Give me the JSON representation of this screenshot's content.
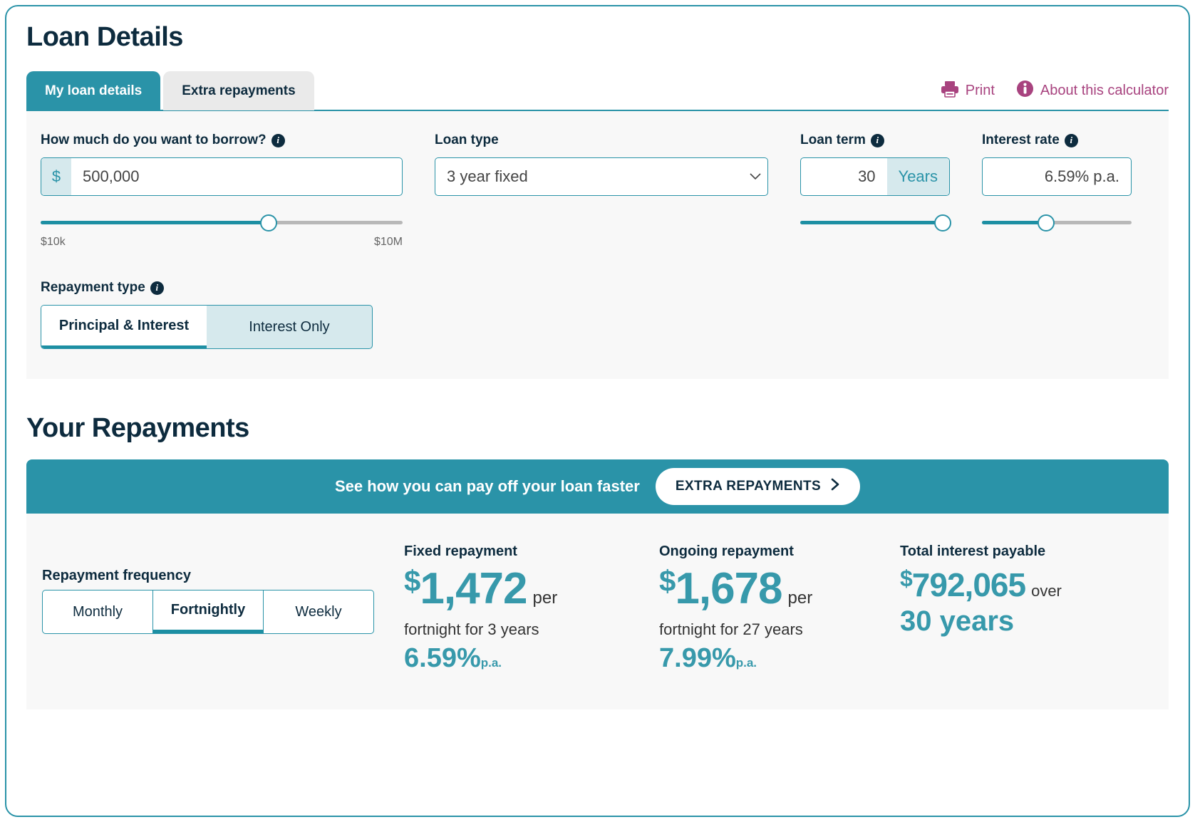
{
  "header": {
    "title": "Loan Details"
  },
  "tabs": [
    {
      "label": "My loan details",
      "active": true
    },
    {
      "label": "Extra repayments",
      "active": false
    }
  ],
  "actions": {
    "print_label": "Print",
    "print_icon": "printer-icon",
    "about_label": "About this calculator",
    "about_icon": "info-circle-icon",
    "link_color": "#a8437f"
  },
  "form": {
    "borrow": {
      "label": "How much do you want to borrow?",
      "info_icon": "info-icon",
      "prefix": "$",
      "value": "500,000",
      "slider": {
        "min_label": "$10k",
        "max_label": "$10M",
        "percent": 63
      }
    },
    "loan_type": {
      "label": "Loan type",
      "value": "3 year fixed",
      "chevron_icon": "chevron-down-icon"
    },
    "loan_term": {
      "label": "Loan term",
      "info_icon": "info-icon",
      "value": "30",
      "suffix": "Years",
      "slider": {
        "percent": 95
      }
    },
    "interest_rate": {
      "label": "Interest rate",
      "info_icon": "info-icon",
      "value": "6.59% p.a.",
      "slider": {
        "percent": 43
      }
    },
    "repayment_type": {
      "label": "Repayment type",
      "info_icon": "info-icon",
      "options": [
        {
          "label": "Principal & Interest",
          "active": true
        },
        {
          "label": "Interest Only",
          "active": false
        }
      ]
    }
  },
  "repayments": {
    "section_title": "Your Repayments",
    "banner": {
      "text": "See how you can pay off your loan faster",
      "button_label": "EXTRA REPAYMENTS",
      "button_icon": "chevron-right-icon",
      "background": "#2a93a8"
    },
    "frequency": {
      "label": "Repayment frequency",
      "options": [
        {
          "label": "Monthly",
          "active": false
        },
        {
          "label": "Fortnightly",
          "active": true
        },
        {
          "label": "Weekly",
          "active": false
        }
      ]
    },
    "fixed": {
      "label": "Fixed repayment",
      "currency": "$",
      "amount": "1,472",
      "per": "per",
      "sub": "fortnight for 3 years",
      "rate": "6.59%",
      "rate_suffix": "p.a."
    },
    "ongoing": {
      "label": "Ongoing repayment",
      "currency": "$",
      "amount": "1,678",
      "per": "per",
      "sub": "fortnight for 27 years",
      "rate": "7.99%",
      "rate_suffix": "p.a."
    },
    "total": {
      "label": "Total interest payable",
      "currency": "$",
      "amount": "792,065",
      "over": "over",
      "years": "30 years"
    }
  }
}
